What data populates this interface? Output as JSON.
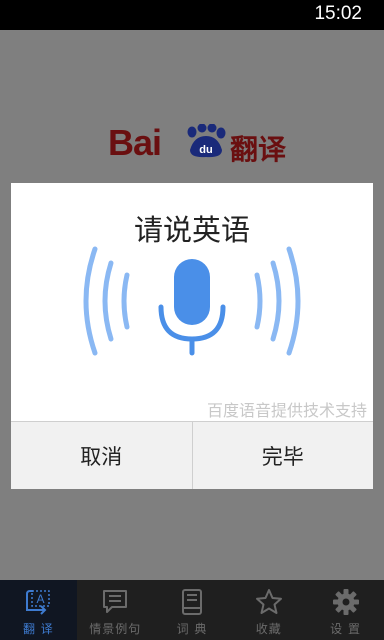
{
  "status_bar": {
    "time": "15:02"
  },
  "logo": {
    "brand": "Bai",
    "badge": "du",
    "suffix": "翻译"
  },
  "dialog": {
    "title": "请说英语",
    "credit": "百度语音提供技术支持",
    "cancel_label": "取消",
    "done_label": "完毕"
  },
  "tabs": [
    {
      "label": "翻 译",
      "icon": "translate-icon",
      "active": true
    },
    {
      "label": "情景例句",
      "icon": "chat-icon",
      "active": false
    },
    {
      "label": "词 典",
      "icon": "dictionary-icon",
      "active": false
    },
    {
      "label": "收藏",
      "icon": "star-icon",
      "active": false
    },
    {
      "label": "设 置",
      "icon": "gear-icon",
      "active": false
    }
  ],
  "colors": {
    "accent": "#3e7bd0",
    "mic": "#4a8fe8",
    "brand_red": "#6a0f10",
    "brand_blue": "#1a2a7a"
  }
}
